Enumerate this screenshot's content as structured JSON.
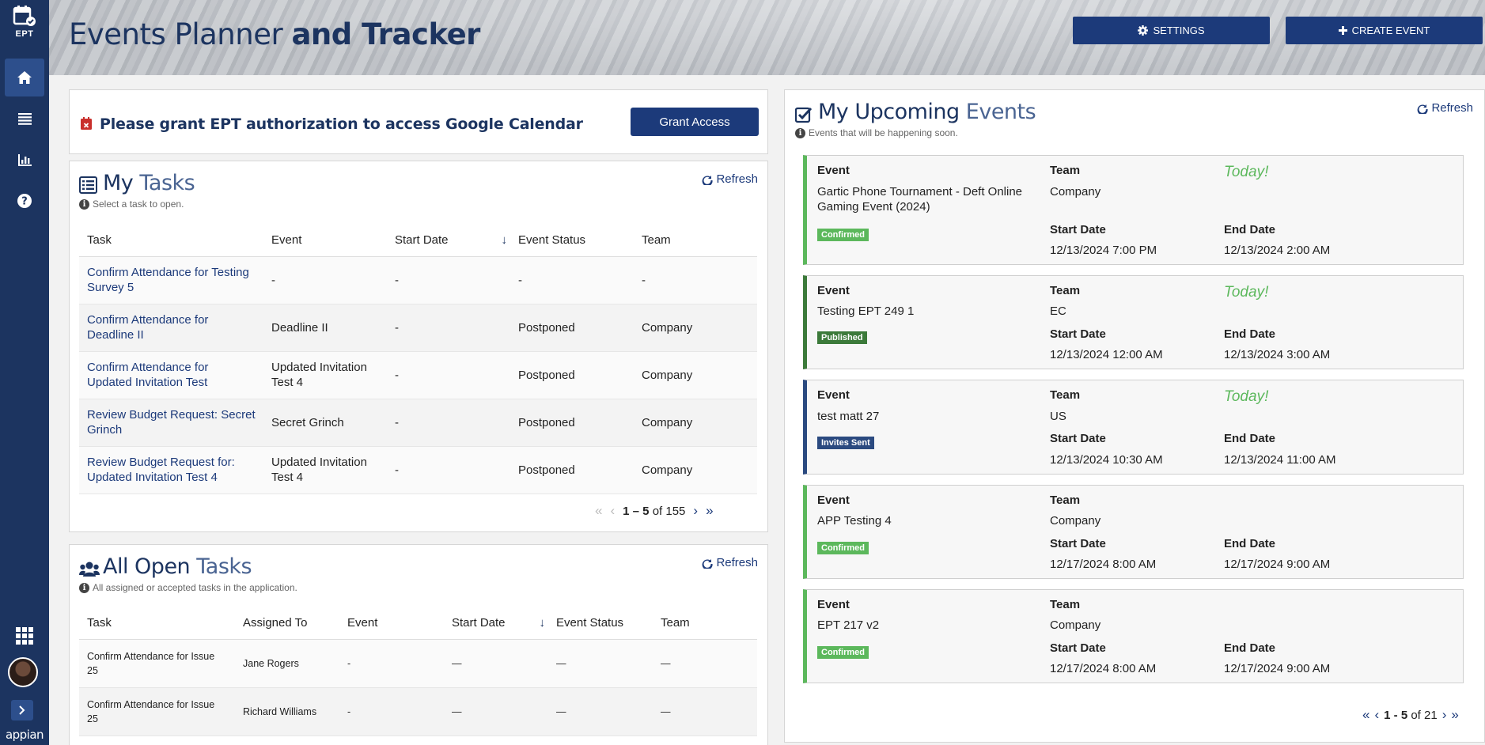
{
  "nav": {
    "logo_text": "EPT",
    "brand": "appian"
  },
  "header": {
    "title_regular": "Events Planner",
    "title_bold": "and Tracker",
    "settings_label": "SETTINGS",
    "create_label": "CREATE EVENT"
  },
  "auth": {
    "message": "Please grant EPT authorization to access Google Calendar",
    "button": "Grant Access"
  },
  "my_tasks": {
    "title_bold": "My",
    "title_light": "Tasks",
    "subtitle": "Select a task to open.",
    "refresh": "Refresh",
    "columns": [
      "Task",
      "Event",
      "Start Date",
      "Event Status",
      "Team"
    ],
    "rows": [
      {
        "task": "Confirm Attendance for Testing Survey 5",
        "event": "-",
        "start": "-",
        "status": "-",
        "team": "-"
      },
      {
        "task": "Confirm Attendance for Deadline II",
        "event": "Deadline II",
        "start": "-",
        "status": "Postponed",
        "team": "Company"
      },
      {
        "task": "Confirm Attendance for Updated Invitation Test",
        "event": "Updated Invitation Test 4",
        "start": "-",
        "status": "Postponed",
        "team": "Company"
      },
      {
        "task": "Review Budget Request: Secret Grinch",
        "event": "Secret Grinch",
        "start": "-",
        "status": "Postponed",
        "team": "Company"
      },
      {
        "task": "Review Budget Request for: Updated Invitation Test 4",
        "event": "Updated Invitation Test 4",
        "start": "-",
        "status": "Postponed",
        "team": "Company"
      }
    ],
    "pager_range": "1 – 5",
    "pager_of": "of 155"
  },
  "open_tasks": {
    "title_bold": "All Open",
    "title_light": "Tasks",
    "subtitle": "All assigned or accepted tasks in the application.",
    "refresh": "Refresh",
    "columns": [
      "Task",
      "Assigned To",
      "Event",
      "Start Date",
      "Event Status",
      "Team"
    ],
    "rows": [
      {
        "task": "Confirm Attendance for Issue 25",
        "assigned": "Jane Rogers",
        "event": "-",
        "start": "—",
        "status": "—",
        "team": "—"
      },
      {
        "task": "Confirm Attendance for Issue 25",
        "assigned": "Richard Williams",
        "event": "-",
        "start": "—",
        "status": "—",
        "team": "—"
      }
    ]
  },
  "upcoming": {
    "title_bold": "My Upcoming",
    "title_light": "Events",
    "subtitle": "Events that will be happening soon.",
    "refresh": "Refresh",
    "labels": {
      "event": "Event",
      "team": "Team",
      "start": "Start Date",
      "end": "End Date"
    },
    "events": [
      {
        "name": "Gartic Phone Tournament - Deft Online Gaming Event (2024)",
        "team": "Company",
        "today": "Today!",
        "status": "Confirmed",
        "start": "12/13/2024 7:00 PM",
        "end": "12/13/2024 2:00 AM"
      },
      {
        "name": "Testing EPT 249 1",
        "team": "EC",
        "today": "Today!",
        "status": "Published",
        "start": "12/13/2024 12:00 AM",
        "end": "12/13/2024 3:00 AM"
      },
      {
        "name": "test matt 27",
        "team": "US",
        "today": "Today!",
        "status": "Invites Sent",
        "start": "12/13/2024 10:30 AM",
        "end": "12/13/2024 11:00 AM"
      },
      {
        "name": "APP Testing 4",
        "team": "Company",
        "today": "",
        "status": "Confirmed",
        "start": "12/17/2024 8:00 AM",
        "end": "12/17/2024 9:00 AM"
      },
      {
        "name": "EPT 217 v2",
        "team": "Company",
        "today": "",
        "status": "Confirmed",
        "start": "12/17/2024 8:00 AM",
        "end": "12/17/2024 9:00 AM"
      }
    ],
    "pager_range": "1 - 5",
    "pager_of": "of 21"
  },
  "colors": {
    "nav": "#1c3460",
    "primary": "#1c3a7a",
    "confirmed": "#5cb85c",
    "published": "#3c7a3a",
    "invites_sent": "#2b4a80"
  }
}
